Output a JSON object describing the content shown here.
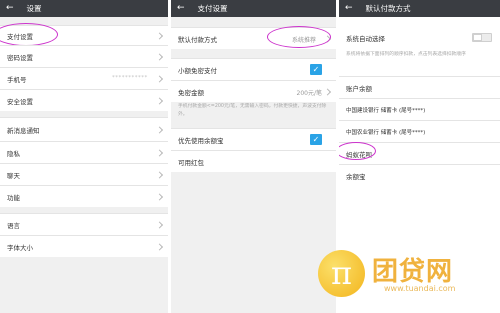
{
  "panel1": {
    "title": "设置",
    "back_icon": "back-arrow-icon",
    "items": [
      {
        "label": "支付设置"
      },
      {
        "label": "密码设置"
      },
      {
        "label": "手机号",
        "value": "***********"
      },
      {
        "label": "安全设置"
      },
      {
        "label": "新消息通知"
      },
      {
        "label": "隐私"
      },
      {
        "label": "聊天"
      },
      {
        "label": "功能"
      },
      {
        "label": "语言"
      },
      {
        "label": "字体大小"
      }
    ]
  },
  "panel2": {
    "title": "支付设置",
    "default_method": {
      "label": "默认付款方式",
      "value": "系统推荐"
    },
    "small_pay": {
      "label": "小额免密支付",
      "checked": true
    },
    "limit": {
      "label": "免密金额",
      "value": "200元/笔"
    },
    "note": "手机付款金额<=200元/笔，无需输入密码，付款更快捷，声波支付除外。",
    "balance_first": {
      "label": "优先使用余额宝",
      "checked": true
    },
    "red_packet": {
      "label": "可用红包"
    }
  },
  "panel3": {
    "title": "默认付款方式",
    "auto_select": {
      "label": "系统自动选择",
      "on": false
    },
    "description": "系统将依据下面排列的顺序扣款，点击列表选择扣款顺序",
    "items": [
      {
        "label": "账户余额"
      },
      {
        "label": "中国建设银行 储蓄卡 (尾号****)"
      },
      {
        "label": "中国农业银行 储蓄卡 (尾号****)"
      },
      {
        "label": "蚂蚁花呗"
      },
      {
        "label": "余额宝"
      }
    ]
  },
  "watermark": {
    "symbol": "π",
    "brand": "团贷网",
    "url": "www.tuandai.com"
  },
  "colors": {
    "titlebar": "#3a3d42",
    "accent": "#2aa3e6",
    "highlight_ring": "#cc33cc",
    "watermark": "#f0b23e"
  }
}
